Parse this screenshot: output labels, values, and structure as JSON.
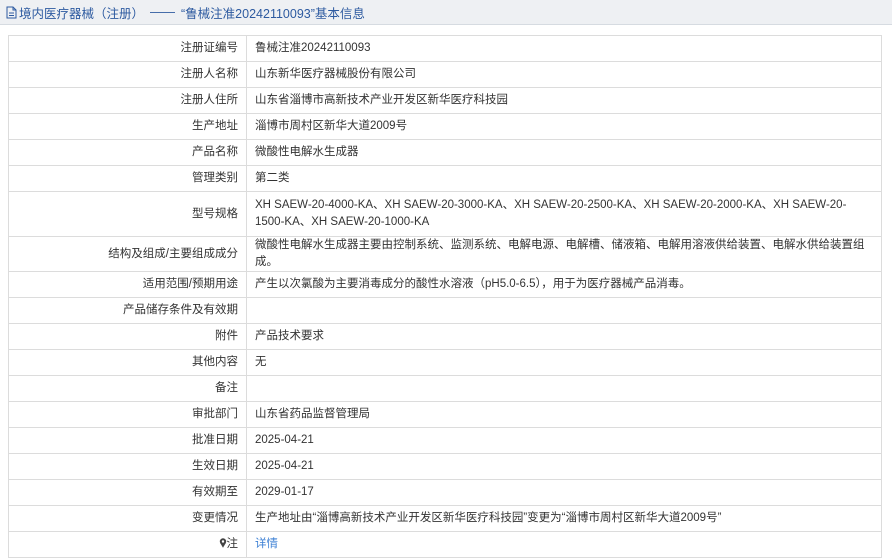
{
  "header": {
    "category": "境内医疗器械（注册）",
    "separator": "——",
    "title": "“鲁械注准20242110093”基本信息"
  },
  "rows": [
    {
      "label": "注册证编号",
      "value": "鲁械注准20242110093"
    },
    {
      "label": "注册人名称",
      "value": "山东新华医疗器械股份有限公司"
    },
    {
      "label": "注册人住所",
      "value": "山东省淄博市高新技术产业开发区新华医疗科技园"
    },
    {
      "label": "生产地址",
      "value": "淄博市周村区新华大道2009号"
    },
    {
      "label": "产品名称",
      "value": "微酸性电解水生成器"
    },
    {
      "label": "管理类别",
      "value": "第二类"
    },
    {
      "label": "型号规格",
      "value": "XH SAEW-20-4000-KA、XH SAEW-20-3000-KA、XH SAEW-20-2500-KA、XH SAEW-20-2000-KA、XH SAEW-20-1500-KA、XH SAEW-20-1000-KA"
    },
    {
      "label": "结构及组成/主要组成成分",
      "value": "微酸性电解水生成器主要由控制系统、监测系统、电解电源、电解槽、储液箱、电解用溶液供给装置、电解水供给装置组成。"
    },
    {
      "label": "适用范围/预期用途",
      "value": "产生以次氯酸为主要消毒成分的酸性水溶液（pH5.0-6.5），用于为医疗器械产品消毒。"
    },
    {
      "label": "产品储存条件及有效期",
      "value": ""
    },
    {
      "label": "附件",
      "value": "产品技术要求"
    },
    {
      "label": "其他内容",
      "value": "无"
    },
    {
      "label": "备注",
      "value": ""
    },
    {
      "label": "审批部门",
      "value": "山东省药品监督管理局"
    },
    {
      "label": "批准日期",
      "value": "2025-04-21"
    },
    {
      "label": "生效日期",
      "value": "2025-04-21"
    },
    {
      "label": "有效期至",
      "value": "2029-01-17"
    },
    {
      "label": "变更情况",
      "value": "生产地址由“淄博高新技术产业开发区新华医疗科技园”变更为“淄博市周村区新华大道2009号”"
    }
  ],
  "note_row": {
    "label": "注",
    "link_text": "详情",
    "icon": "pin-icon"
  },
  "colors": {
    "link": "#3b7fd4",
    "header_text": "#2d5aa0",
    "border": "#dcdcdc"
  }
}
